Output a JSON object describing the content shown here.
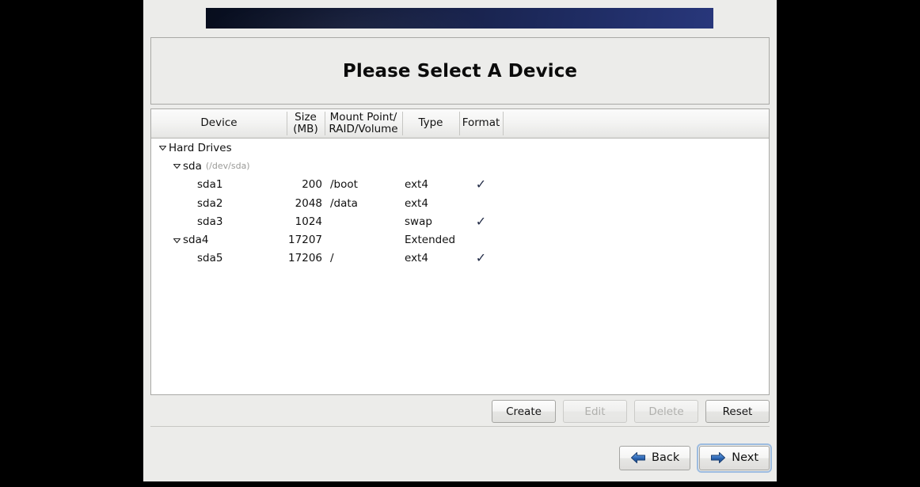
{
  "window": {
    "title": "Please Select A Device",
    "banner_gradient_from": "#070d1d",
    "banner_gradient_to": "#28377b",
    "background": "#ececea"
  },
  "table": {
    "columns": [
      {
        "key": "device",
        "label": "Device"
      },
      {
        "key": "size",
        "label": "Size\n(MB)",
        "label_line1": "Size",
        "label_line2": "(MB)"
      },
      {
        "key": "mount",
        "label": "Mount Point/\nRAID/Volume",
        "label_line1": "Mount Point/",
        "label_line2": "RAID/Volume"
      },
      {
        "key": "type",
        "label": "Type"
      },
      {
        "key": "format",
        "label": "Format"
      }
    ],
    "rows": [
      {
        "indent": 0,
        "twisty": "expanded",
        "device": "Hard Drives",
        "sub": "",
        "size": "",
        "mount": "",
        "type": "",
        "format": ""
      },
      {
        "indent": 1,
        "twisty": "expanded",
        "device": "sda",
        "sub": "(/dev/sda)",
        "size": "",
        "mount": "",
        "type": "",
        "format": ""
      },
      {
        "indent": 2,
        "twisty": "none",
        "device": "sda1",
        "sub": "",
        "size": "200",
        "mount": "/boot",
        "type": "ext4",
        "format": "✓"
      },
      {
        "indent": 2,
        "twisty": "none",
        "device": "sda2",
        "sub": "",
        "size": "2048",
        "mount": "/data",
        "type": "ext4",
        "format": ""
      },
      {
        "indent": 2,
        "twisty": "none",
        "device": "sda3",
        "sub": "",
        "size": "1024",
        "mount": "",
        "type": "swap",
        "format": "✓"
      },
      {
        "indent": 1,
        "twisty": "expanded",
        "device": "sda4",
        "sub": "",
        "size": "17207",
        "mount": "",
        "type": "Extended",
        "format": ""
      },
      {
        "indent": 2,
        "twisty": "none",
        "device": "sda5",
        "sub": "",
        "size": "17206",
        "mount": "/",
        "type": "ext4",
        "format": "✓"
      }
    ],
    "check_color": "#232c47"
  },
  "actions": {
    "create": {
      "label": "Create",
      "enabled": true
    },
    "edit": {
      "label": "Edit",
      "enabled": false
    },
    "delete": {
      "label": "Delete",
      "enabled": false
    },
    "reset": {
      "label": "Reset",
      "enabled": true
    }
  },
  "navigation": {
    "back": {
      "label": "Back",
      "icon": "arrow-left-icon",
      "focused": false
    },
    "next": {
      "label": "Next",
      "icon": "arrow-right-icon",
      "focused": true
    },
    "arrow_color": "#2f66b5"
  }
}
